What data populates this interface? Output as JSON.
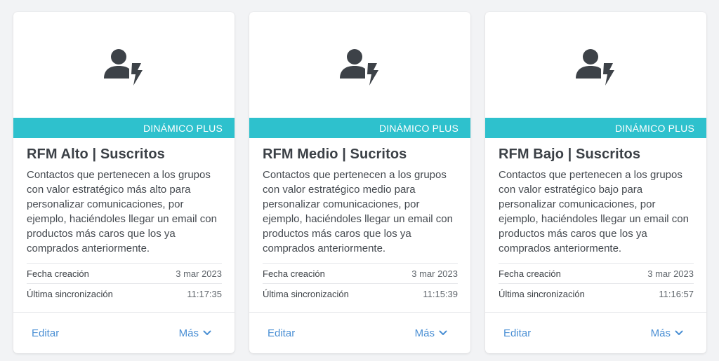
{
  "cards": [
    {
      "badge": "DINÁMICO PLUS",
      "title": "RFM Alto | Suscritos",
      "description": "Contactos que pertenecen a los grupos con valor estratégico más alto para personalizar comunicaciones, por ejemplo, haciéndoles llegar un email con productos más caros que los ya comprados anteriormente.",
      "created_label": "Fecha creación",
      "created_value": "3 mar 2023",
      "sync_label": "Última sincronización",
      "sync_value": "11:17:35",
      "edit_label": "Editar",
      "more_label": "Más",
      "icon": "user-bolt-icon"
    },
    {
      "badge": "DINÁMICO PLUS",
      "title": "RFM Medio | Sucritos",
      "description": "Contactos que pertenecen a los grupos con valor estratégico medio para personalizar comunicaciones, por ejemplo, haciéndoles llegar un email con productos más caros que los ya comprados anteriormente.",
      "created_label": "Fecha creación",
      "created_value": "3 mar 2023",
      "sync_label": "Última sincronización",
      "sync_value": "11:15:39",
      "edit_label": "Editar",
      "more_label": "Más",
      "icon": "user-bolt-icon"
    },
    {
      "badge": "DINÁMICO PLUS",
      "title": "RFM Bajo | Suscritos",
      "description": "Contactos que pertenecen a los grupos con valor estratégico bajo para personalizar comunicaciones, por ejemplo, haciéndoles llegar un email con productos más caros que los ya comprados anteriormente.",
      "created_label": "Fecha creación",
      "created_value": "3 mar 2023",
      "sync_label": "Última sincronización",
      "sync_value": "11:16:57",
      "edit_label": "Editar",
      "more_label": "Más",
      "icon": "user-bolt-icon"
    }
  ],
  "colors": {
    "accent": "#2ec1cd",
    "link": "#4a8fd4",
    "icon": "#3d4248"
  }
}
